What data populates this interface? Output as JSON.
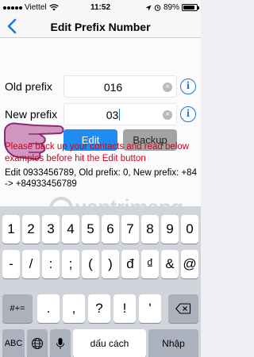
{
  "status_bar": {
    "carrier": "Viettel",
    "time": "11:52",
    "battery": "89%",
    "battery_level": 0.89
  },
  "nav": {
    "title": "Edit Prefix Number",
    "back_icon": "chevron-left-icon"
  },
  "form": {
    "old_prefix_label": "Old prefix",
    "old_prefix_value": "016",
    "new_prefix_label": "New prefix",
    "new_prefix_value": "03",
    "info_glyph": "i"
  },
  "buttons": {
    "edit": "Edit",
    "backup": "Backup"
  },
  "warning": "Please back up your contacts and read below examples before hit the Edit button",
  "example": "Edit 0933456789, Old prefix: 0, New prefix: +84 -> +84933456789",
  "watermark": "uantrimang",
  "keyboard": {
    "row1": [
      "1",
      "2",
      "3",
      "4",
      "5",
      "6",
      "7",
      "8",
      "9",
      "0"
    ],
    "row2": [
      "-",
      "/",
      ":",
      ";",
      "(",
      ")",
      "đ",
      "₫",
      "&",
      "@"
    ],
    "row3": [
      "#+=",
      ".",
      ",",
      "?",
      "!",
      "'"
    ],
    "row4": [
      "ABC",
      "dấu cách",
      "Nhập"
    ],
    "globe_icon": "globe-icon",
    "mic_icon": "microphone-icon",
    "delete_icon": "backspace-icon"
  },
  "colors": {
    "accent": "#1a78d6",
    "edit_button": "#1e8cf0",
    "backup_button": "#a3a3a3",
    "warning_text": "#d0021b"
  }
}
